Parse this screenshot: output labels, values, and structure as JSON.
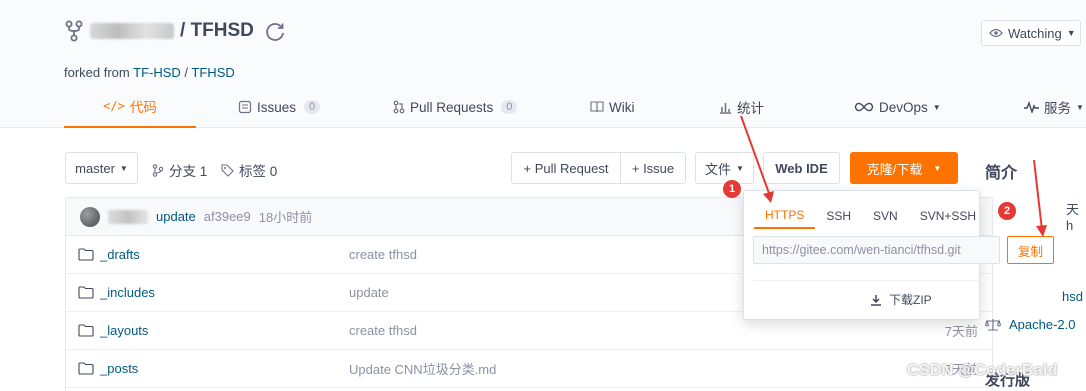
{
  "header": {
    "repo_name": "/ TFHSD",
    "forked_prefix": "forked from",
    "forked_owner": "TF-HSD",
    "forked_sep": " / ",
    "forked_repo": "TFHSD",
    "watch_label": "Watching"
  },
  "tabs": [
    {
      "label": "代码"
    },
    {
      "label": "Issues",
      "count": "0"
    },
    {
      "label": "Pull Requests",
      "count": "0"
    },
    {
      "label": "Wiki"
    },
    {
      "label": "统计"
    },
    {
      "label": "DevOps"
    },
    {
      "label": "服务"
    }
  ],
  "toolbar": {
    "branch": "master",
    "branches": "分支 1",
    "tags": "标签 0",
    "pull_request": "+ Pull Request",
    "issue": "+ Issue",
    "file": "文件",
    "web_ide": "Web IDE",
    "clone": "克隆/下载"
  },
  "sidebar": {
    "intro_title": "简介",
    "partial_text": "天h",
    "partial_hsd": "hsd",
    "license": "Apache-2.0",
    "release": "发行版"
  },
  "commit": {
    "message": "update",
    "hash": "af39ee9",
    "time": "18小时前"
  },
  "files": [
    {
      "name": "_drafts",
      "message": "create tfhsd",
      "time": ""
    },
    {
      "name": "_includes",
      "message": "update",
      "time": ""
    },
    {
      "name": "_layouts",
      "message": "create tfhsd",
      "time": "7天前"
    },
    {
      "name": "_posts",
      "message": "Update CNN垃圾分类.md",
      "time": "7天前"
    }
  ],
  "clone_popup": {
    "tabs": [
      "HTTPS",
      "SSH",
      "SVN",
      "SVN+SSH"
    ],
    "active_tab": "HTTPS",
    "url": "https://gitee.com/wen-tianci/tfhsd.git",
    "copy": "复制",
    "download_zip": "下载ZIP"
  },
  "annotations": {
    "badge_1": "1",
    "badge_2": "2"
  },
  "watermark": "CSDN @CoderBald",
  "colors": {
    "accent": "#fe7300",
    "link": "#005980",
    "annotation_red": "#e53935"
  }
}
